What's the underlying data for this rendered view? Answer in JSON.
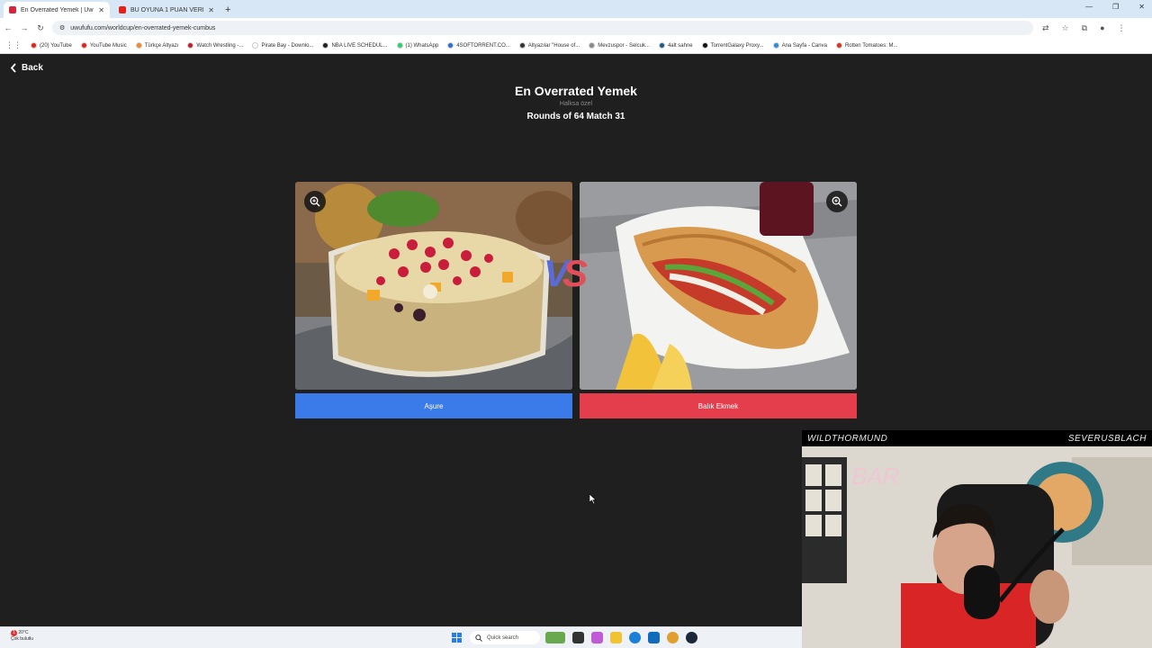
{
  "browser": {
    "tabs": [
      {
        "title": "En Overrated Yemek | UwUFUF",
        "active": true,
        "favicon_color": "#d6263b"
      },
      {
        "title": "BU OYUNA 1 PUAN VERIYORUI...",
        "active": false,
        "favicon_color": "#e62117"
      }
    ],
    "new_tab_symbol": "+",
    "url": "uwufufu.com/worldcup/en-overrated-yemek-cumbus",
    "bookmarks": [
      {
        "label": "(20) YouTube",
        "color": "#e62117"
      },
      {
        "label": "YouTube Music",
        "color": "#e62117"
      },
      {
        "label": "Türkçe Altyazı",
        "color": "#f08a24"
      },
      {
        "label": "Watch Wrestling -...",
        "color": "#c21f2b"
      },
      {
        "label": "Pirate Bay - Downlo...",
        "color": "#ffffff"
      },
      {
        "label": "NBA LIVE SCHEDUL...",
        "color": "#222222"
      },
      {
        "label": "(1) WhatsApp",
        "color": "#25d366"
      },
      {
        "label": "4SOFTORRENT.CO...",
        "color": "#2a6fd6"
      },
      {
        "label": "Altyazılar \"House of...",
        "color": "#333333"
      },
      {
        "label": "Mevzuspor - Selcuk...",
        "color": "#888888"
      },
      {
        "label": "4alt sahne",
        "color": "#1a5a8a"
      },
      {
        "label": "TorrentGalaxy Proxy...",
        "color": "#111111"
      },
      {
        "label": "Ana Sayfa - Canva",
        "color": "#2a8de0"
      },
      {
        "label": "Rotten Tomatoes: M...",
        "color": "#e0311b"
      }
    ]
  },
  "page": {
    "back_label": "Back",
    "title": "En Overrated Yemek",
    "subtitle": "Halksa özel",
    "round_label": "Rounds of 64 Match 31",
    "vs_v": "V",
    "vs_s": "S",
    "left_choice": {
      "label": "Aşure",
      "button_color": "#3b7be9"
    },
    "right_choice": {
      "label": "Balık Ekmek",
      "button_color": "#e43d4b"
    }
  },
  "webcam": {
    "left_name": "WILDTHORMUND",
    "right_name": "SEVERUSBLACH",
    "neon_sign": "BAR"
  },
  "taskbar": {
    "temperature": "20°C",
    "weather": "Çok bulutlu",
    "search_label": "Quick search",
    "notification_count": "1"
  }
}
